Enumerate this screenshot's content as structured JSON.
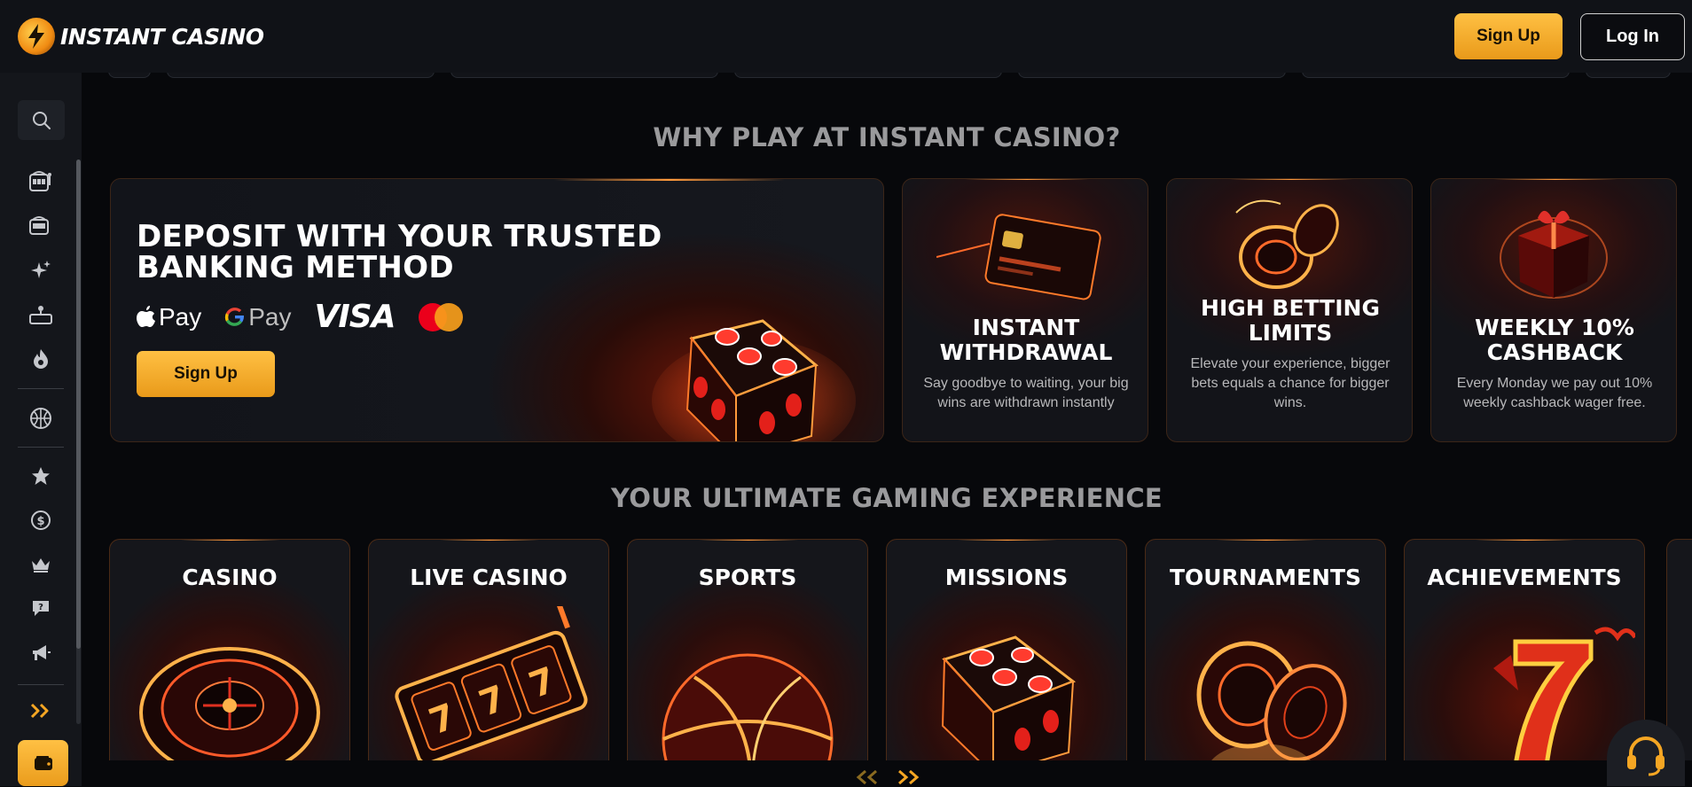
{
  "header": {
    "logo_text": "INSTANT CASINO",
    "signup_label": "Sign Up",
    "login_label": "Log In"
  },
  "sidebar": {
    "items": [
      {
        "icon": "search-icon"
      },
      {
        "icon": "slot-machine-icon"
      },
      {
        "icon": "slot-machine-alt-icon"
      },
      {
        "icon": "sparkles-icon"
      },
      {
        "icon": "live-dealer-icon"
      },
      {
        "icon": "fire-icon"
      },
      {
        "icon": "sports-icon"
      },
      {
        "icon": "star-icon"
      },
      {
        "icon": "coin-icon"
      },
      {
        "icon": "crown-icon"
      },
      {
        "icon": "chat-help-icon"
      },
      {
        "icon": "megaphone-icon"
      },
      {
        "icon": "expand-icon"
      },
      {
        "icon": "wallet-icon"
      }
    ]
  },
  "why_section": {
    "title": "WHY PLAY AT INSTANT CASINO?"
  },
  "deposit_banner": {
    "title": "DEPOSIT WITH YOUR TRUSTED BANKING METHOD",
    "apple_pay": "Pay",
    "google_pay": "Pay",
    "visa": "VISA",
    "button_label": "Sign Up"
  },
  "features": [
    {
      "title": "INSTANT WITHDRAWAL",
      "description": "Say goodbye to waiting, your big wins are withdrawn instantly",
      "icon": "credit-card-icon"
    },
    {
      "title": "HIGH BETTING LIMITS",
      "description": "Elevate your experience, bigger bets equals a chance for bigger wins.",
      "icon": "chips-icon"
    },
    {
      "title": "WEEKLY 10% CASHBACK",
      "description": "Every Monday we pay out 10% weekly cashback wager free.",
      "icon": "gift-icon"
    }
  ],
  "gaming_section": {
    "title": "YOUR ULTIMATE GAMING EXPERIENCE"
  },
  "games": [
    {
      "title": "CASINO",
      "icon": "roulette-icon"
    },
    {
      "title": "LIVE CASINO",
      "icon": "slot-reels-icon"
    },
    {
      "title": "SPORTS",
      "icon": "basketball-icon"
    },
    {
      "title": "MISSIONS",
      "icon": "dice-icon"
    },
    {
      "title": "TOURNAMENTS",
      "icon": "poker-chips-icon"
    },
    {
      "title": "ACHIEVEMENTS",
      "icon": "lucky-seven-icon"
    }
  ],
  "colors": {
    "accent": "#f5a623",
    "background": "#07080b",
    "card_glow": "#e3401a",
    "title_gray": "#9a9a9c"
  }
}
